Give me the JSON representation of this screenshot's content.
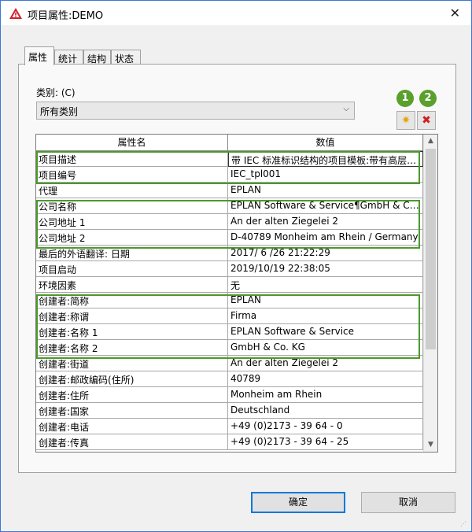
{
  "window": {
    "title": "项目属性:DEMO",
    "close": "✕"
  },
  "tabs": [
    {
      "label": "属性"
    },
    {
      "label": "统计"
    },
    {
      "label": "结构"
    },
    {
      "label": "状态"
    }
  ],
  "category": {
    "label": "类别: (C)",
    "selected": "所有类别"
  },
  "badges": {
    "one": "1",
    "two": "2"
  },
  "toolbar": {
    "add_glyph": "✷",
    "delete_glyph": "✖"
  },
  "grid": {
    "headers": {
      "name": "属性名",
      "value": "数值"
    },
    "rows": [
      {
        "name": "项目描述",
        "value": "带 IEC 标准标识结构的项目模板:带有高层…"
      },
      {
        "name": "项目编号",
        "value": "IEC_tpl001"
      },
      {
        "name": "代理",
        "value": "EPLAN"
      },
      {
        "name": "公司名称",
        "value": "EPLAN Software & Service¶GmbH & Co…"
      },
      {
        "name": "公司地址 1",
        "value": "An der alten Ziegelei 2"
      },
      {
        "name": "公司地址 2",
        "value": "D-40789 Monheim am Rhein / Germany"
      },
      {
        "name": "最后的外语翻译: 日期",
        "value": "2017/ 6 /26 21:22:29"
      },
      {
        "name": "项目启动",
        "value": "2019/10/19 22:38:05"
      },
      {
        "name": "环境因素",
        "value": "无"
      },
      {
        "name": "创建者:简称",
        "value": "EPLAN"
      },
      {
        "name": "创建者:称谓",
        "value": "Firma"
      },
      {
        "name": "创建者:名称 1",
        "value": "EPLAN Software & Service"
      },
      {
        "name": "创建者:名称 2",
        "value": "GmbH & Co. KG"
      },
      {
        "name": "创建者:街道",
        "value": "An der alten Ziegelei 2"
      },
      {
        "name": "创建者:邮政编码(住所)",
        "value": "40789"
      },
      {
        "name": "创建者:住所",
        "value": "Monheim am Rhein"
      },
      {
        "name": "创建者:国家",
        "value": "Deutschland"
      },
      {
        "name": "创建者:电话",
        "value": "+49 (0)2173 - 39 64 - 0"
      },
      {
        "name": "创建者:传真",
        "value": "+49 (0)2173 - 39 64 - 25"
      }
    ]
  },
  "buttons": {
    "ok": "确定",
    "cancel": "取消"
  },
  "colors": {
    "highlight": "#4a9a2a",
    "badge": "#5aa02c",
    "accent": "#0078d7"
  }
}
